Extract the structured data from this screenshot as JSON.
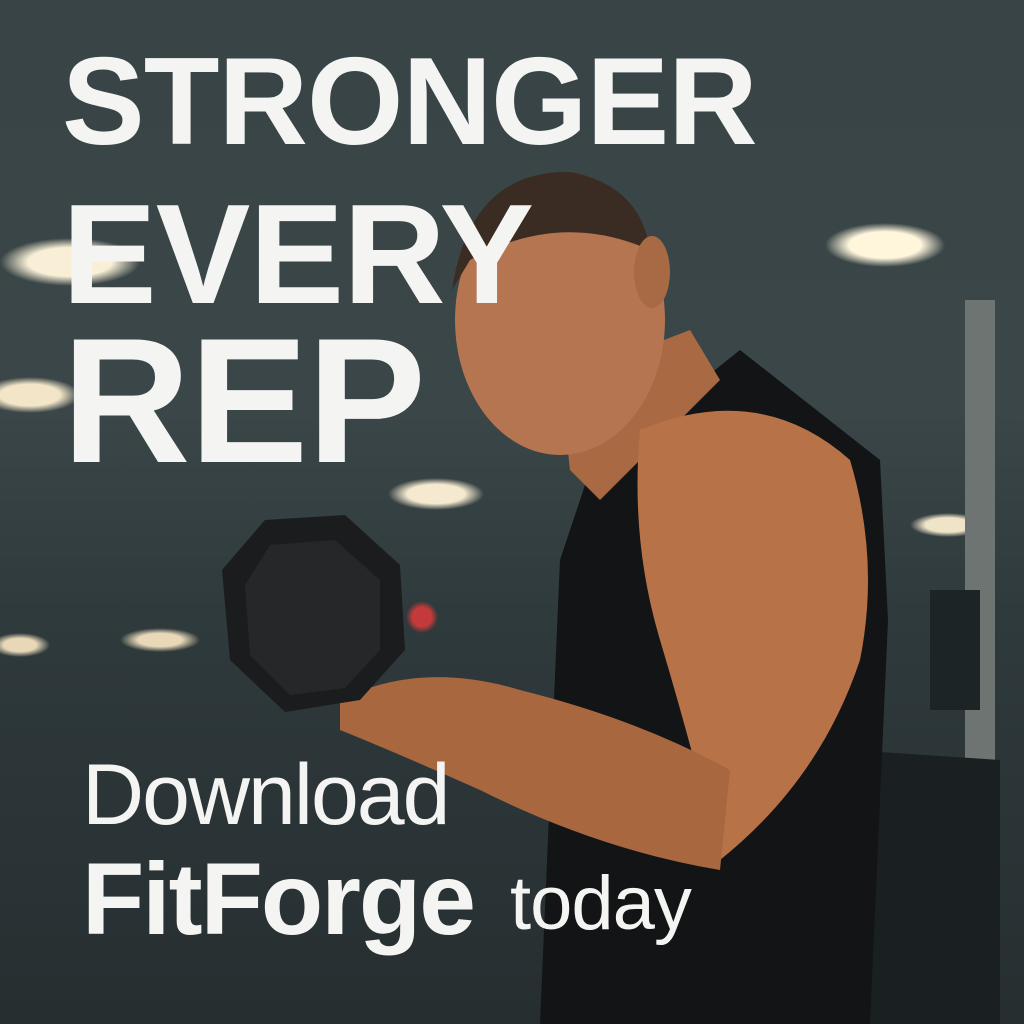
{
  "headline": {
    "line1": "STRONGER",
    "line2": "EVERY",
    "line3": "REP"
  },
  "cta": {
    "line1": "Download",
    "brand": "FitForge",
    "suffix": "today"
  },
  "colors": {
    "text": "#f4f4f2",
    "background": "#2b3436",
    "skin": "#b8744a",
    "shirt": "#121416"
  }
}
